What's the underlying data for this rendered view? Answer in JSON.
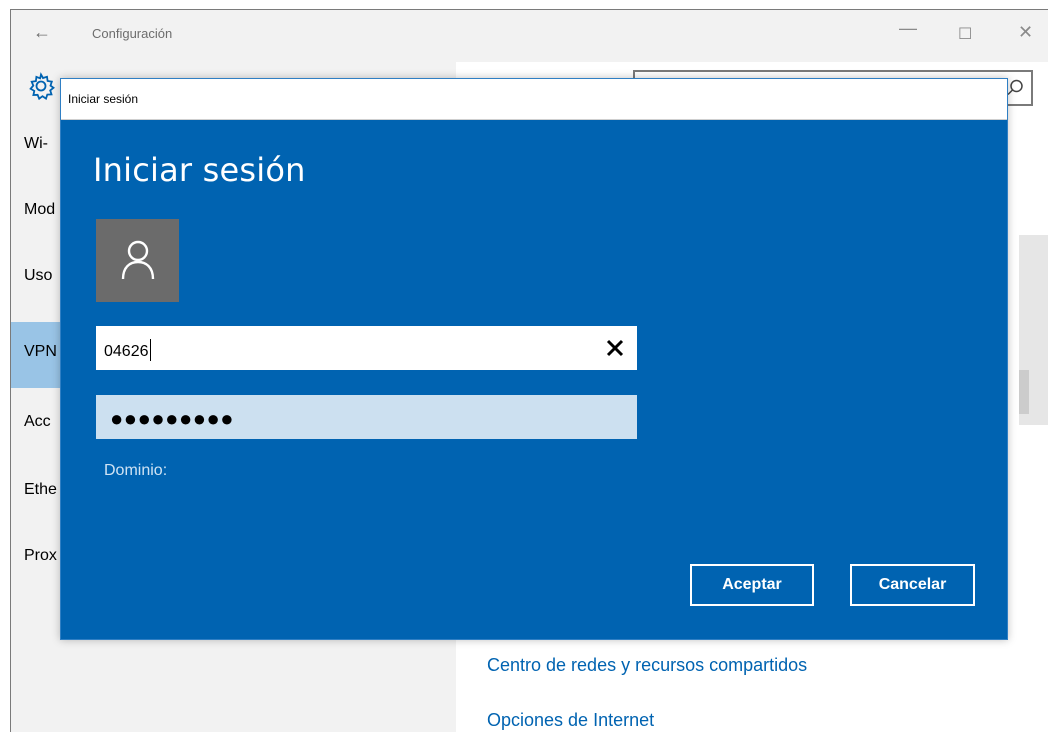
{
  "window": {
    "back_icon": "back-arrow-icon",
    "title": "Configuración",
    "minimize_glyph": "—",
    "maximize_glyph": "☐",
    "close_glyph": "✕"
  },
  "sidebar": {
    "items": [
      {
        "label": "Wi-"
      },
      {
        "label": "Mod"
      },
      {
        "label": "Uso"
      },
      {
        "label": "VPN",
        "selected": true
      },
      {
        "label": "Acc"
      },
      {
        "label": "Ethe"
      },
      {
        "label": "Prox"
      }
    ]
  },
  "links": {
    "network_center": "Centro de redes y recursos compartidos",
    "internet_options": "Opciones de Internet"
  },
  "dialog": {
    "window_title": "Iniciar sesión",
    "heading": "Iniciar sesión",
    "username_value": "04626",
    "password_mask": "●●●●●●●●●",
    "domain_label": "Dominio:",
    "ok_label": "Aceptar",
    "cancel_label": "Cancelar"
  },
  "colors": {
    "dialog_blue": "#0063b1",
    "selected_item": "#99c4e6",
    "avatar_grey": "#6b6b6b",
    "password_bg": "#cce0f0",
    "link_blue": "#0063b1"
  }
}
